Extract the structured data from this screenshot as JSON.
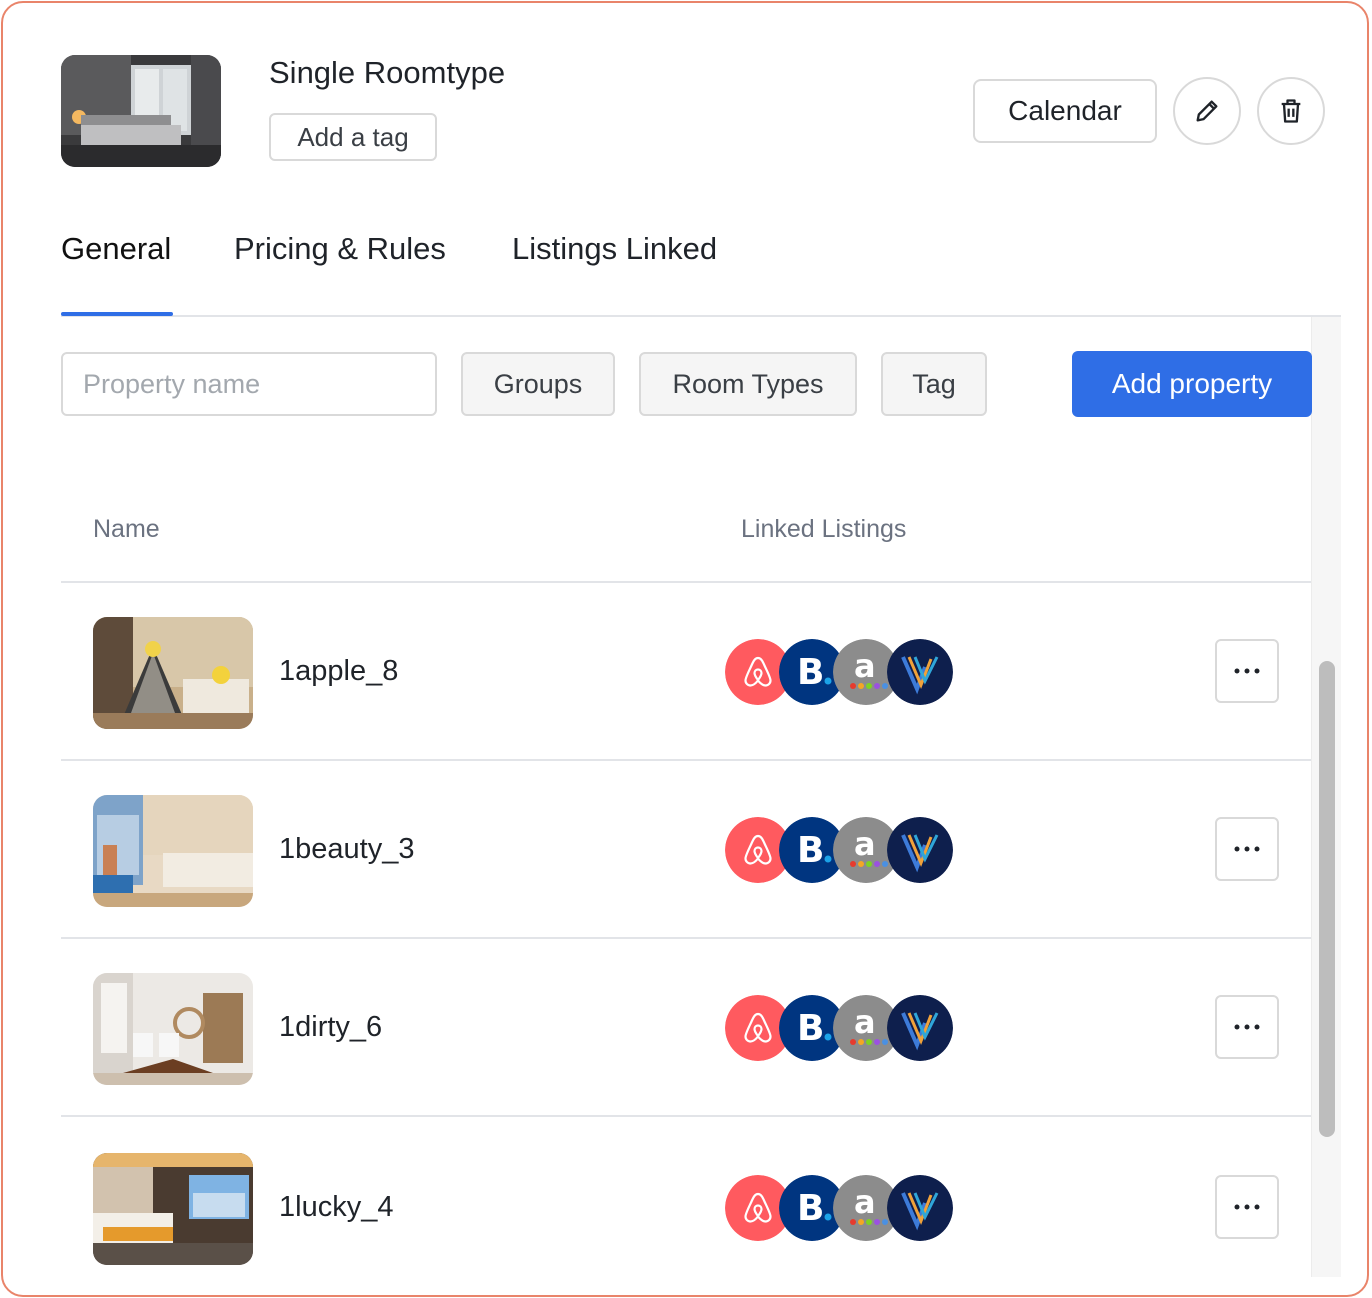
{
  "header": {
    "title": "Single Roomtype",
    "add_tag_label": "Add a tag",
    "calendar_label": "Calendar"
  },
  "tabs": [
    {
      "label": "General",
      "active": true
    },
    {
      "label": "Pricing & Rules",
      "active": false
    },
    {
      "label": "Listings Linked",
      "active": false
    }
  ],
  "filters": {
    "search_placeholder": "Property name",
    "groups_label": "Groups",
    "room_types_label": "Room Types",
    "tag_label": "Tag",
    "add_property_label": "Add property"
  },
  "table": {
    "columns": [
      "Name",
      "Linked Listings"
    ],
    "rows": [
      {
        "name": "1apple_8",
        "listings": [
          "airbnb",
          "booking",
          "agoda",
          "vrbo"
        ]
      },
      {
        "name": "1beauty_3",
        "listings": [
          "airbnb",
          "booking",
          "agoda",
          "vrbo"
        ]
      },
      {
        "name": "1dirty_6",
        "listings": [
          "airbnb",
          "booking",
          "agoda",
          "vrbo"
        ]
      },
      {
        "name": "1lucky_4",
        "listings": [
          "airbnb",
          "booking",
          "agoda",
          "vrbo"
        ]
      }
    ]
  },
  "colors": {
    "accent": "#2f6ee6",
    "frame_border": "#e9846a",
    "airbnb": "#ff5a5f",
    "booking": "#003580",
    "agoda": "#8c8c8c",
    "vrbo": "#0e1f4d"
  }
}
